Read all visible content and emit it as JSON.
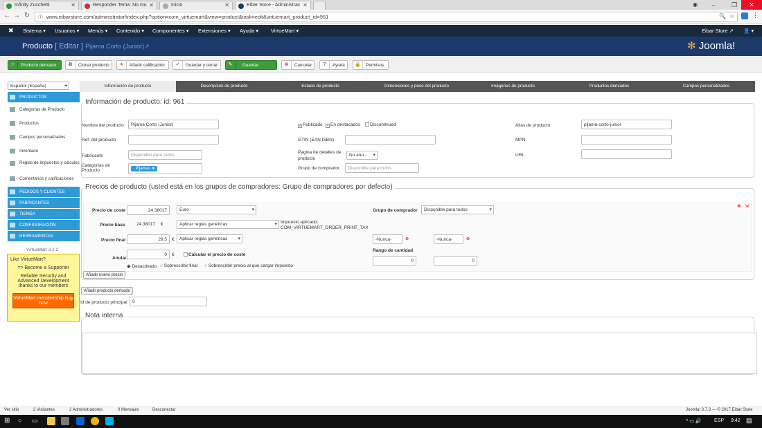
{
  "browser": {
    "tabs": [
      {
        "label": "Infinity Zucchetti"
      },
      {
        "label": "Responder Tema: No mu"
      },
      {
        "label": "Inicio"
      },
      {
        "label": "Eibar Store - Administrac"
      }
    ],
    "url": "www.eibarstore.com/administrator/index.php?option=com_virtuemart&view=product&task=edit&virtuemart_product_id=961",
    "window_close": "✕",
    "window_min": "–",
    "window_max": "❐"
  },
  "adminbar": {
    "menus": [
      "Sistema ▾",
      "Usuarios ▾",
      "Menús ▾",
      "Contenido ▾",
      "Componentes ▾",
      "Extensiones ▾",
      "Ayuda ▾",
      "VirtueMart ▾"
    ],
    "site": "Eibar Store ↗",
    "user": "👤 ▾"
  },
  "header": {
    "title": "Producto",
    "edit": "[ Editar ]",
    "product": "Pijama Corto (Junior)↗",
    "logo": "Joomla!"
  },
  "toolbar": [
    {
      "label": "Producto derivado",
      "icon": "+"
    },
    {
      "label": "Clonar producto",
      "icon": "⧉"
    },
    {
      "label": "Añadir calificación",
      "icon": "★"
    },
    {
      "label": "Guardar y cerrar",
      "icon": "✓"
    },
    {
      "label": "Guardar",
      "icon": "✎"
    },
    {
      "label": "Cancelar",
      "icon": "⊗"
    },
    {
      "label": "Ayuda",
      "icon": "?"
    },
    {
      "label": "Permisos",
      "icon": "🔒"
    }
  ],
  "sidebar": {
    "lang": "Español (España)",
    "items": [
      "PRODUCTOS",
      "Categorías de Producto",
      "Productos",
      "Campos personalizados",
      "Inventario",
      "Reglas de impuestos y cálculos",
      "Comentarios y calificaciones",
      "PEDIDOS Y CLIENTES",
      "FABRICANTES",
      "TIENDA",
      "CONFIGURACIÓN",
      "HERRAMIENTAS"
    ],
    "version": "VirtueMart 3.2.2",
    "promo": {
      "q": "Like VirtueMart?",
      "l1": "=> Become a Supporter",
      "l2": "Reliable Security and Advanced Development thanks to our members",
      "btn": "VirtueMart membership Buy now"
    }
  },
  "tabs": [
    "Información de producto",
    "Descripción de producto",
    "Estado de producto",
    "Dimensiones y peso del producto",
    "Imágenes de producto",
    "Productos derivados",
    "Campos personalizados"
  ],
  "info": {
    "legend": "Información de producto: id: 961",
    "name_label": "Nombre del producto",
    "name": "Pijama Corto (Junior)",
    "ref_label": "Ref. del producto",
    "ref": "",
    "maker_label": "Fabricante",
    "maker_ph": "Disponible para todos",
    "cat_label": "Categorías de Producto",
    "cat_tag": "Pijamas",
    "published": "Publicado",
    "featured": "En destacados",
    "discontinued": "Discontinued",
    "gtin_label": "GTIN (EAN,ISBN)",
    "page_label": "Pagina de detalles de producto",
    "page_val": "No anu...",
    "group_label": "Grupo de comprador",
    "group_ph": "Disponible para todos",
    "alias_label": "Alias de producto",
    "alias": "pijama-corto-junior",
    "mpn_label": "MPN",
    "url_label": "URL"
  },
  "prices": {
    "legend": "Precios de producto (usted está en los grupos de compradores: Grupo de compradores por defecto)",
    "cost_label": "Precio de coste",
    "cost": "24.38017",
    "currency": "Euro",
    "buyer_group_label": "Grupo de comprador",
    "buyer_group": "Disponible para todos",
    "base_label": "Precio base",
    "base": "24.38017",
    "eur": "€",
    "rule1": "Aplicar reglas genéricas",
    "tax_label": "Impuesto aplicado:",
    "tax": "COM_VIRTUEMART_ORDER_PRINT_TAX",
    "final_label": "Precio final",
    "final": "29.5",
    "rule2": "Aplicar reglas genéricas",
    "never1": "-Nunca-",
    "never2": "-Nunca-",
    "qty_label": "Rango de cantidad",
    "qty1": "0",
    "qty2": "0",
    "override_label": "Anular",
    "override": "0",
    "calc_cost": "Calcular el precio de coste",
    "r1": "Desactivado",
    "r2": "Sobrescribir final",
    "r3": "Sobrescribir precio al que cargar impuesto",
    "add_price": "Añadir nuevo precio"
  },
  "derived_btn": "Añadir producto derivado",
  "parent_label": "Id de producto principal",
  "parent": "0",
  "note_legend": "Nota interna",
  "status": {
    "items": [
      "Ver sitio",
      "2 Visitantes",
      "2 Administradores",
      "0 Mensajes",
      "Desconectar"
    ],
    "right": "Joomla! 3.7.3 — © 2017 Eibar Store"
  },
  "taskbar": {
    "lang": "ESP",
    "time": "9:42"
  }
}
